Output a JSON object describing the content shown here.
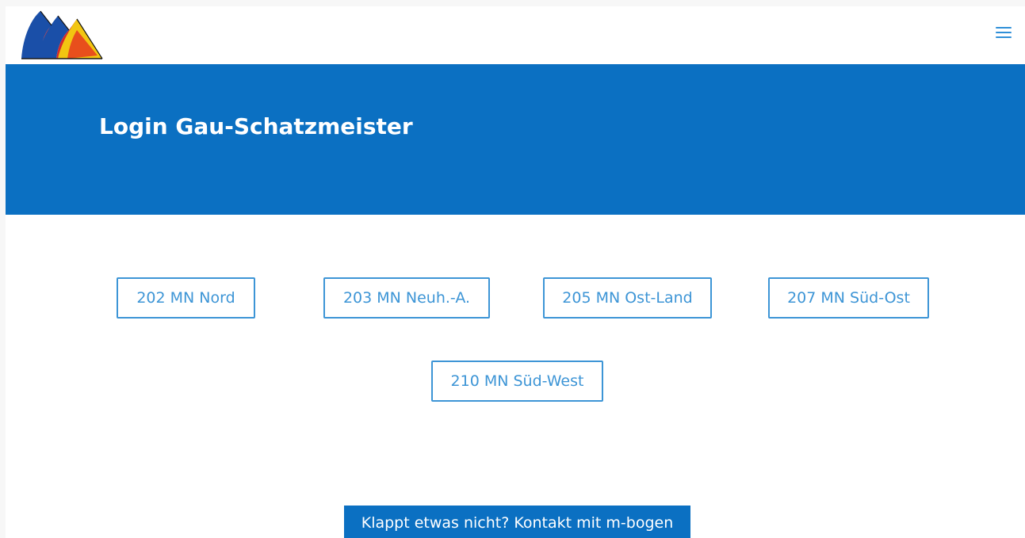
{
  "header": {
    "logo_icon": "archery-club-logo-icon",
    "menu_icon": "hamburger-menu-icon"
  },
  "hero": {
    "title": "Login Gau-Schatzmeister"
  },
  "districts": [
    {
      "label": "202 MN Nord"
    },
    {
      "label": "203 MN Neuh.-A."
    },
    {
      "label": "205 MN Ost-Land"
    },
    {
      "label": "207 MN Süd-Ost"
    },
    {
      "label": "210 MN Süd-West"
    }
  ],
  "contact": {
    "label": "Klappt etwas nicht? Kontakt mit m-bogen"
  },
  "colors": {
    "accent": "#0b70c2",
    "outline": "#3d95d6",
    "background": "#ffffff"
  }
}
